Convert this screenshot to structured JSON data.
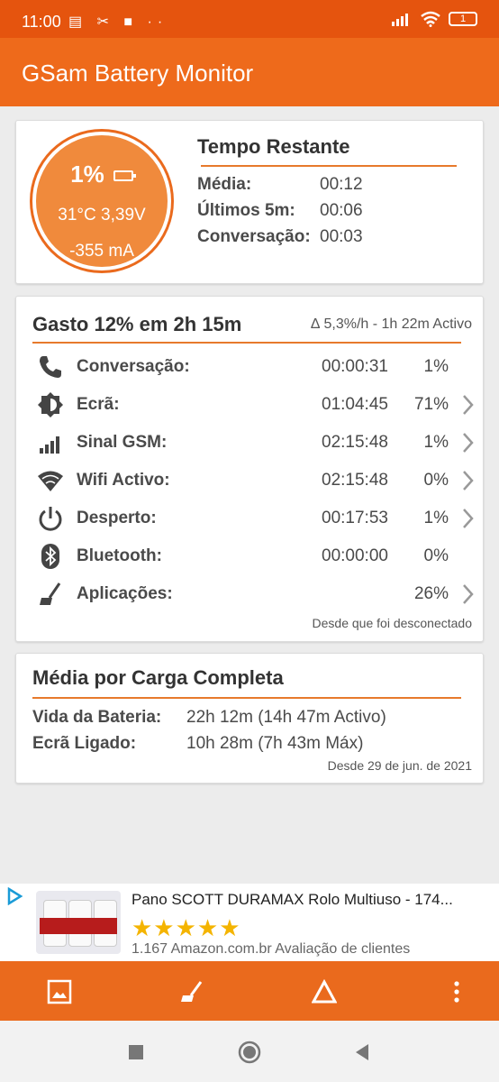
{
  "status_bar": {
    "time": "11:00",
    "notif_icons": "▤ ✂ ■ ··",
    "battery_text": "1"
  },
  "app_bar": {
    "title": "GSam Battery Monitor"
  },
  "gauge": {
    "percent": "1%",
    "temp_voltage": "31°C  3,39V",
    "current": "-355 mA",
    "color": "#f08a3c"
  },
  "tempo": {
    "title": "Tempo Restante",
    "rows": [
      {
        "label": "Média:",
        "value": "00:12"
      },
      {
        "label": "Últimos 5m:",
        "value": "00:06"
      },
      {
        "label": "Conversação:",
        "value": "00:03"
      }
    ]
  },
  "gasto": {
    "title": "Gasto 12% em 2h 15m",
    "subtitle": "∆ 5,3%/h - 1h 22m Activo",
    "items": [
      {
        "icon": "phone-icon",
        "label": "Conversação:",
        "time": "00:00:31",
        "pct": "1%",
        "chevron": false
      },
      {
        "icon": "screen-brightness-icon",
        "label": "Ecrã:",
        "time": "01:04:45",
        "pct": "71%",
        "chevron": true
      },
      {
        "icon": "signal-bars-icon",
        "label": "Sinal GSM:",
        "time": "02:15:48",
        "pct": "1%",
        "chevron": true
      },
      {
        "icon": "wifi-icon",
        "label": "Wifi Activo:",
        "time": "02:15:48",
        "pct": "0%",
        "chevron": true
      },
      {
        "icon": "power-icon",
        "label": "Desperto:",
        "time": "00:17:53",
        "pct": "1%",
        "chevron": true
      },
      {
        "icon": "bluetooth-icon",
        "label": "Bluetooth:",
        "time": "00:00:00",
        "pct": "0%",
        "chevron": false
      },
      {
        "icon": "apps-broom-icon",
        "label": "Aplicações:",
        "time": "",
        "pct": "26%",
        "chevron": true
      }
    ],
    "footnote": "Desde que foi desconectado"
  },
  "media": {
    "title": "Média por Carga Completa",
    "rows": [
      {
        "label": "Vida da Bateria:",
        "value": "22h 12m (14h 47m Activo)"
      },
      {
        "label": "Ecrã Ligado:",
        "value": "10h 28m (7h 43m Máx)"
      }
    ],
    "footnote": "Desde 29 de jun. de 2021"
  },
  "ad": {
    "title": "Pano SCOTT DURAMAX Rolo Multiuso - 174...",
    "stars": "★★★★★",
    "rating_count_text": "1.167 Amazon.com.br Avaliação de clientes"
  },
  "colors": {
    "orange_dark": "#e5540e",
    "orange": "#ee6a1b",
    "accent_rule": "#e77a2c"
  }
}
